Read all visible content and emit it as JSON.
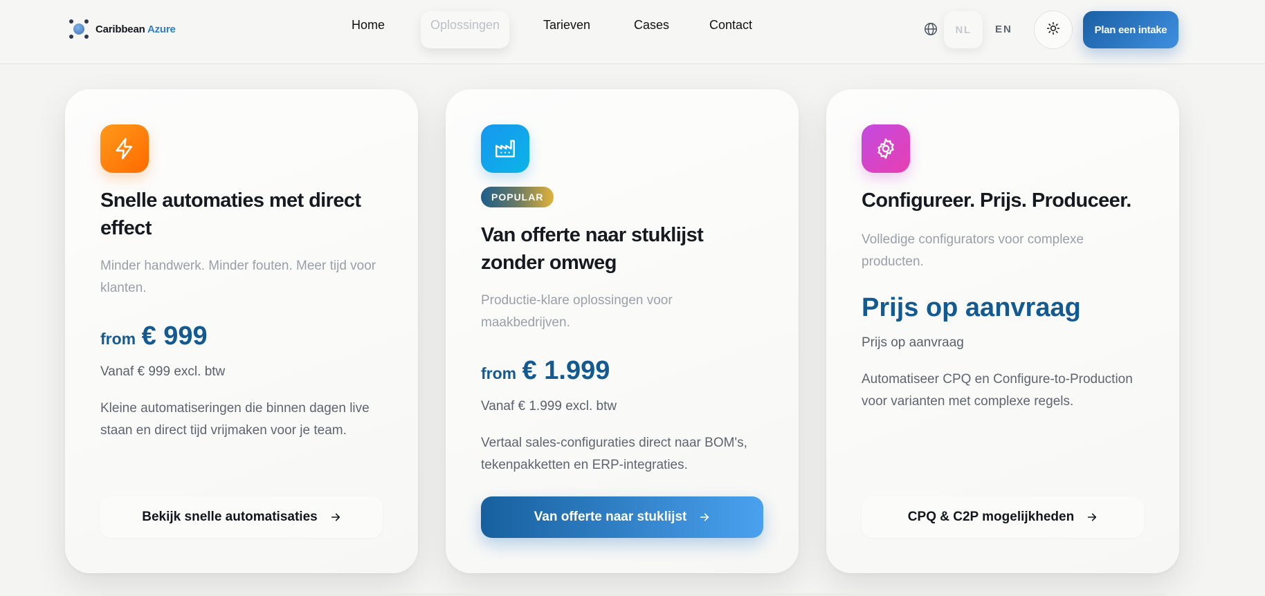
{
  "header": {
    "brand": {
      "name": "Caribbean",
      "accent": "Azure"
    },
    "nav": [
      {
        "label": "Home",
        "active": false
      },
      {
        "label": "Oplossingen",
        "active": true
      },
      {
        "label": "Tarieven",
        "active": false
      },
      {
        "label": "Cases",
        "active": false
      },
      {
        "label": "Contact",
        "active": false
      }
    ],
    "languages": {
      "current": "NL",
      "other": "EN"
    },
    "theme_icon": "sun-icon",
    "cta_label": "Plan een intake"
  },
  "cards": [
    {
      "icon": "lightning-icon",
      "title": "Snelle automaties met direct effect",
      "subtitle": "Minder handwerk. Minder fouten. Meer tijd voor klanten.",
      "price_from": "from",
      "price_amount": "€ 999",
      "price_note": "Vanaf € 999 excl. btw",
      "description": "Kleine automatiseringen die binnen dagen live staan en direct tijd vrijmaken voor je team.",
      "button_label": "Bekijk snelle automatisaties"
    },
    {
      "icon": "factory-icon",
      "badge": "POPULAR",
      "title": "Van offerte naar stuklijst zonder omweg",
      "subtitle": "Productie-klare oplossingen voor maakbedrijven.",
      "price_from": "from",
      "price_amount": "€ 1.999",
      "price_note": "Vanaf € 1.999 excl. btw",
      "description": "Vertaal sales-configuraties direct naar BOM's, tekenpakketten en ERP-integraties.",
      "button_label": "Van offerte naar stuklijst"
    },
    {
      "icon": "gear-icon",
      "title": "Configureer. Prijs. Produceer.",
      "subtitle": "Volledige configurators voor complexe producten.",
      "price_text": "Prijs op aanvraag",
      "price_note": "Prijs op aanvraag",
      "description": "Automatiseer CPQ en Configure-to-Production voor varianten met complexe regels.",
      "button_label": "CPQ & C2P mogelijkheden"
    }
  ],
  "colors": {
    "brand_blue": "#135a93",
    "cta_gradient_start": "#1a5fa3",
    "cta_gradient_end": "#3f8fe0",
    "icon_orange": "#ff7a00",
    "icon_blue": "#1797ee",
    "icon_purple": "#c24ae0"
  }
}
